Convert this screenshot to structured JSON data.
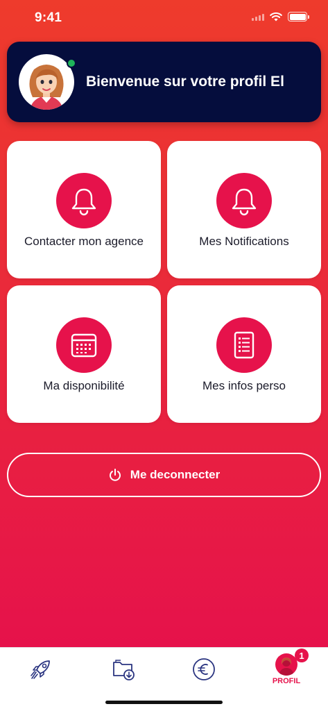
{
  "status_bar": {
    "time": "9:41"
  },
  "welcome": {
    "title": "Bienvenue sur votre profil El"
  },
  "tiles": [
    {
      "label": "Contacter mon agence",
      "icon": "bell-icon"
    },
    {
      "label": "Mes Notifications",
      "icon": "bell-icon"
    },
    {
      "label": "Ma disponibilité",
      "icon": "calendar-icon"
    },
    {
      "label": "Mes infos perso",
      "icon": "document-icon"
    }
  ],
  "logout": {
    "label": "Me deconnecter",
    "icon": "power-icon"
  },
  "tab_bar": {
    "tabs": [
      {
        "icon": "rocket-icon"
      },
      {
        "icon": "folder-download-icon"
      },
      {
        "icon": "euro-icon"
      },
      {
        "icon": "profile-avatar-icon",
        "label": "PROFIL",
        "badge": "1",
        "active": true
      }
    ]
  },
  "colors": {
    "accent": "#e6124b",
    "navy": "#050d3d",
    "tab_icon": "#2a3480"
  }
}
